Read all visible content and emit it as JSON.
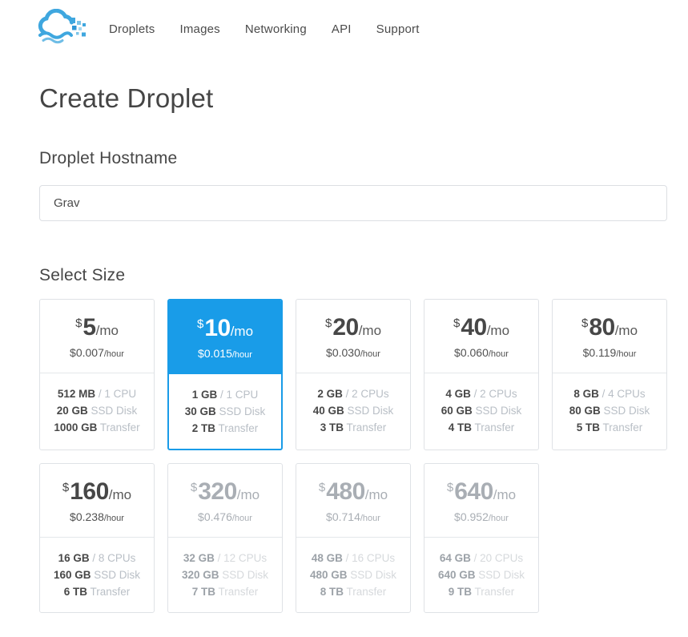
{
  "colors": {
    "accent_blue": "#199ce8",
    "text_dark": "#4a4a4a",
    "muted_gray": "#b9bfc6",
    "card_border": "#dfe2e6"
  },
  "nav": {
    "logo": "digitalocean-cloud-logo",
    "items": [
      "Droplets",
      "Images",
      "Networking",
      "API",
      "Support"
    ]
  },
  "page": {
    "title": "Create Droplet"
  },
  "hostname": {
    "label": "Droplet Hostname",
    "value": "Grav"
  },
  "size": {
    "label": "Select Size",
    "units": {
      "currency": "$",
      "per_month": "/mo",
      "per_hour": "/hour",
      "ssd": "SSD Disk",
      "transfer": "Transfer"
    },
    "plans": [
      {
        "monthly": "5",
        "hourly": "$0.007",
        "ram": "512 MB",
        "cpu": "/ 1 CPU",
        "disk": "20 GB",
        "transfer": "1000 GB",
        "state": "normal"
      },
      {
        "monthly": "10",
        "hourly": "$0.015",
        "ram": "1 GB",
        "cpu": "/ 1 CPU",
        "disk": "30 GB",
        "transfer": "2 TB",
        "state": "selected"
      },
      {
        "monthly": "20",
        "hourly": "$0.030",
        "ram": "2 GB",
        "cpu": "/ 2 CPUs",
        "disk": "40 GB",
        "transfer": "3 TB",
        "state": "normal"
      },
      {
        "monthly": "40",
        "hourly": "$0.060",
        "ram": "4 GB",
        "cpu": "/ 2 CPUs",
        "disk": "60 GB",
        "transfer": "4 TB",
        "state": "normal"
      },
      {
        "monthly": "80",
        "hourly": "$0.119",
        "ram": "8 GB",
        "cpu": "/ 4 CPUs",
        "disk": "80 GB",
        "transfer": "5 TB",
        "state": "normal"
      },
      {
        "monthly": "160",
        "hourly": "$0.238",
        "ram": "16 GB",
        "cpu": "/ 8 CPUs",
        "disk": "160 GB",
        "transfer": "6 TB",
        "state": "normal"
      },
      {
        "monthly": "320",
        "hourly": "$0.476",
        "ram": "32 GB",
        "cpu": "/ 12 CPUs",
        "disk": "320 GB",
        "transfer": "7 TB",
        "state": "disabled"
      },
      {
        "monthly": "480",
        "hourly": "$0.714",
        "ram": "48 GB",
        "cpu": "/ 16 CPUs",
        "disk": "480 GB",
        "transfer": "8 TB",
        "state": "disabled"
      },
      {
        "monthly": "640",
        "hourly": "$0.952",
        "ram": "64 GB",
        "cpu": "/ 20 CPUs",
        "disk": "640 GB",
        "transfer": "9 TB",
        "state": "disabled"
      }
    ]
  }
}
